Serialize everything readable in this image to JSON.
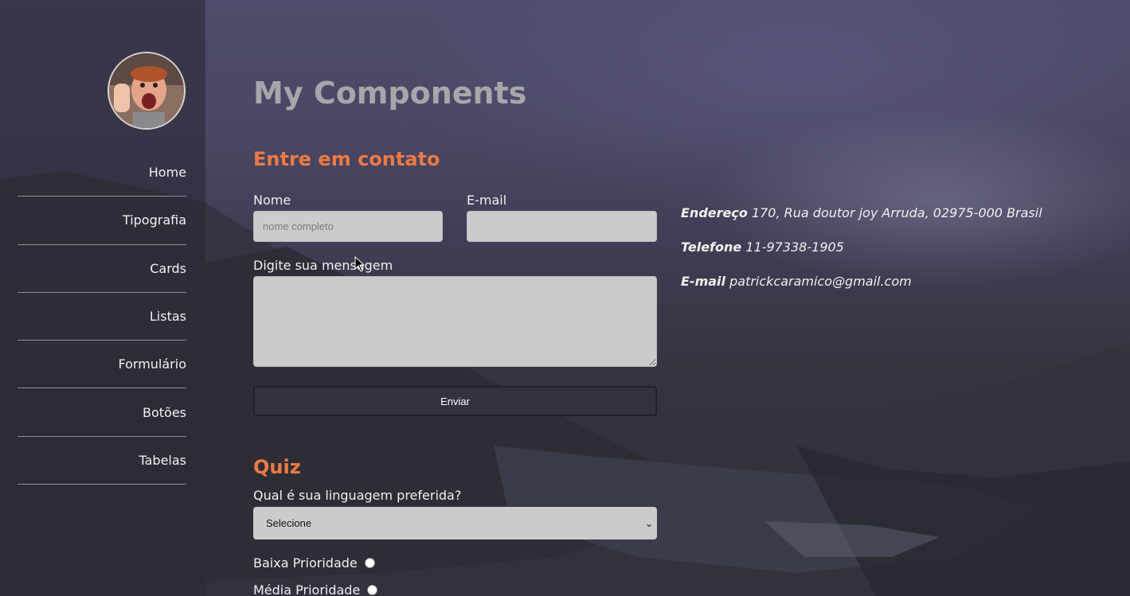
{
  "colors": {
    "accent": "#ee7a45",
    "title": "#a9a6ab",
    "field_bg": "#cbcbcb",
    "button_bg": "#31323c"
  },
  "sidebar": {
    "avatar_icon": "profile-photo",
    "items": [
      {
        "label": "Home"
      },
      {
        "label": "Tipografia"
      },
      {
        "label": "Cards"
      },
      {
        "label": "Listas"
      },
      {
        "label": "Formulário"
      },
      {
        "label": "Botões"
      },
      {
        "label": "Tabelas"
      }
    ]
  },
  "main": {
    "title": "My Components",
    "contact": {
      "heading": "Entre em contato",
      "name_label": "Nome",
      "name_placeholder": "nome completo",
      "name_value": "",
      "email_label": "E-mail",
      "email_value": "",
      "message_label": "Digite sua mensagem",
      "message_value": "",
      "submit_label": "Enviar"
    },
    "info": {
      "address_label": "Endereço",
      "address_value": "170, Rua doutor joy Arruda, 02975-000 Brasil",
      "phone_label": "Telefone",
      "phone_value": "11-97338-1905",
      "email_label": "E-mail",
      "email_value": "patrickcaramico@gmail.com"
    },
    "quiz": {
      "heading": "Quiz",
      "question": "Qual é sua linguagem preferida?",
      "select_value": "Selecione",
      "options": [
        {
          "label": "Baixa Prioridade"
        },
        {
          "label": "Média Prioridade"
        }
      ]
    }
  }
}
